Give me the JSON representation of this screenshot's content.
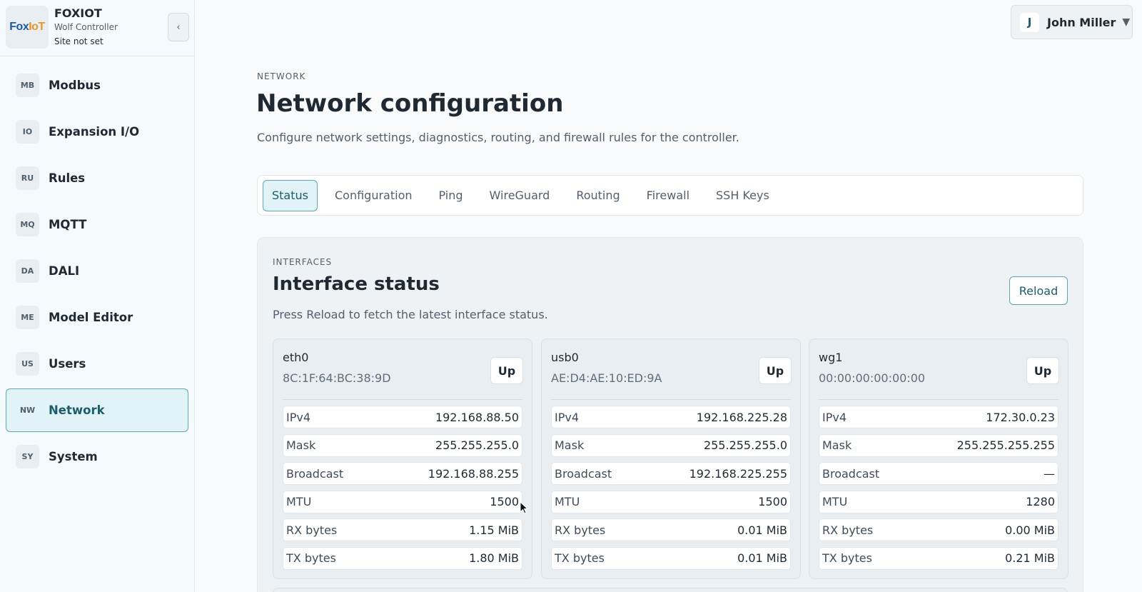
{
  "brand": {
    "logo_text_a": "Fox",
    "logo_text_b": "IoT",
    "name": "FOXIOT",
    "subtitle": "Wolf Controller",
    "site": "Site not set",
    "collapse_icon": "‹"
  },
  "sidebar": {
    "items": [
      {
        "abbr": "MB",
        "label": "Modbus",
        "active": false
      },
      {
        "abbr": "IO",
        "label": "Expansion I/O",
        "active": false
      },
      {
        "abbr": "RU",
        "label": "Rules",
        "active": false
      },
      {
        "abbr": "MQ",
        "label": "MQTT",
        "active": false
      },
      {
        "abbr": "DA",
        "label": "DALI",
        "active": false
      },
      {
        "abbr": "ME",
        "label": "Model Editor",
        "active": false
      },
      {
        "abbr": "US",
        "label": "Users",
        "active": false
      },
      {
        "abbr": "NW",
        "label": "Network",
        "active": true
      },
      {
        "abbr": "SY",
        "label": "System",
        "active": false
      }
    ]
  },
  "user": {
    "initial": "J",
    "name": "John Miller",
    "caret": "▼"
  },
  "header": {
    "eyebrow": "NETWORK",
    "title": "Network configuration",
    "description": "Configure network settings, diagnostics, routing, and firewall rules for the controller."
  },
  "tabs": [
    {
      "label": "Status",
      "active": true
    },
    {
      "label": "Configuration",
      "active": false
    },
    {
      "label": "Ping",
      "active": false
    },
    {
      "label": "WireGuard",
      "active": false
    },
    {
      "label": "Routing",
      "active": false
    },
    {
      "label": "Firewall",
      "active": false
    },
    {
      "label": "SSH Keys",
      "active": false
    }
  ],
  "panel": {
    "eyebrow": "INTERFACES",
    "title": "Interface status",
    "description": "Press Reload to fetch the latest interface status.",
    "reload_label": "Reload"
  },
  "interfaces": [
    {
      "name": "eth0",
      "mac": "8C:1F:64:BC:38:9D",
      "state": "Up",
      "rows": [
        {
          "key": "IPv4",
          "value": "192.168.88.50"
        },
        {
          "key": "Mask",
          "value": "255.255.255.0"
        },
        {
          "key": "Broadcast",
          "value": "192.168.88.255"
        },
        {
          "key": "MTU",
          "value": "1500"
        },
        {
          "key": "RX bytes",
          "value": "1.15 MiB"
        },
        {
          "key": "TX bytes",
          "value": "1.80 MiB"
        }
      ]
    },
    {
      "name": "usb0",
      "mac": "AE:D4:AE:10:ED:9A",
      "state": "Up",
      "rows": [
        {
          "key": "IPv4",
          "value": "192.168.225.28"
        },
        {
          "key": "Mask",
          "value": "255.255.255.0"
        },
        {
          "key": "Broadcast",
          "value": "192.168.225.255"
        },
        {
          "key": "MTU",
          "value": "1500"
        },
        {
          "key": "RX bytes",
          "value": "0.01 MiB"
        },
        {
          "key": "TX bytes",
          "value": "0.01 MiB"
        }
      ]
    },
    {
      "name": "wg1",
      "mac": "00:00:00:00:00:00",
      "state": "Up",
      "rows": [
        {
          "key": "IPv4",
          "value": "172.30.0.23"
        },
        {
          "key": "Mask",
          "value": "255.255.255.255"
        },
        {
          "key": "Broadcast",
          "value": "—"
        },
        {
          "key": "MTU",
          "value": "1280"
        },
        {
          "key": "RX bytes",
          "value": "0.00 MiB"
        },
        {
          "key": "TX bytes",
          "value": "0.21 MiB"
        }
      ]
    }
  ]
}
